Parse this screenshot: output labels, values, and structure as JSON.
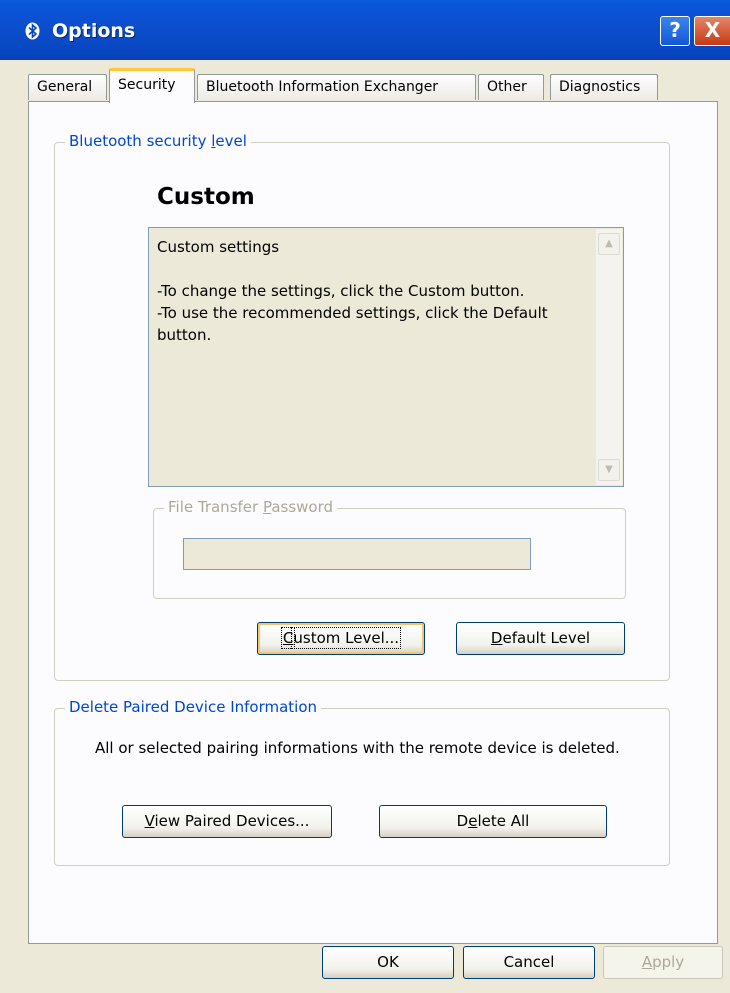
{
  "window": {
    "title": "Options",
    "help_label": "?",
    "close_label": "X"
  },
  "tabs": [
    {
      "label": "General"
    },
    {
      "label": "Security"
    },
    {
      "label": "Bluetooth Information Exchanger"
    },
    {
      "label": "Other"
    },
    {
      "label": "Diagnostics"
    }
  ],
  "security_group": {
    "legend_pre": "Bluetooth security ",
    "legend_accel": "l",
    "legend_post": "evel",
    "level_heading": "Custom",
    "description": "Custom settings\n\n-To change the settings, click the Custom button.\n-To use the recommended settings, click the Default button.",
    "password_group": {
      "legend_pre": "File Transfer ",
      "legend_accel": "P",
      "legend_post": "assword",
      "value": ""
    },
    "custom_button": {
      "accel": "C",
      "rest": "ustom Level..."
    },
    "default_button": {
      "accel": "D",
      "rest": "efault Level"
    }
  },
  "paired_group": {
    "legend": "Delete Paired Device Information",
    "description": "All or selected pairing informations with the remote device is deleted.",
    "view_button": {
      "accel": "V",
      "rest": "iew Paired Devices..."
    },
    "delete_button": {
      "pre": "D",
      "accel": "e",
      "rest": "lete All"
    }
  },
  "footer": {
    "ok_label": "OK",
    "cancel_label": "Cancel",
    "apply_accel": "A",
    "apply_rest": "pply"
  },
  "colors": {
    "titlebar": "#0a55d8",
    "legend_blue": "#0046d5",
    "dialog_bg": "#ece9d8",
    "active_tab_highlight": "#ffc83c"
  }
}
